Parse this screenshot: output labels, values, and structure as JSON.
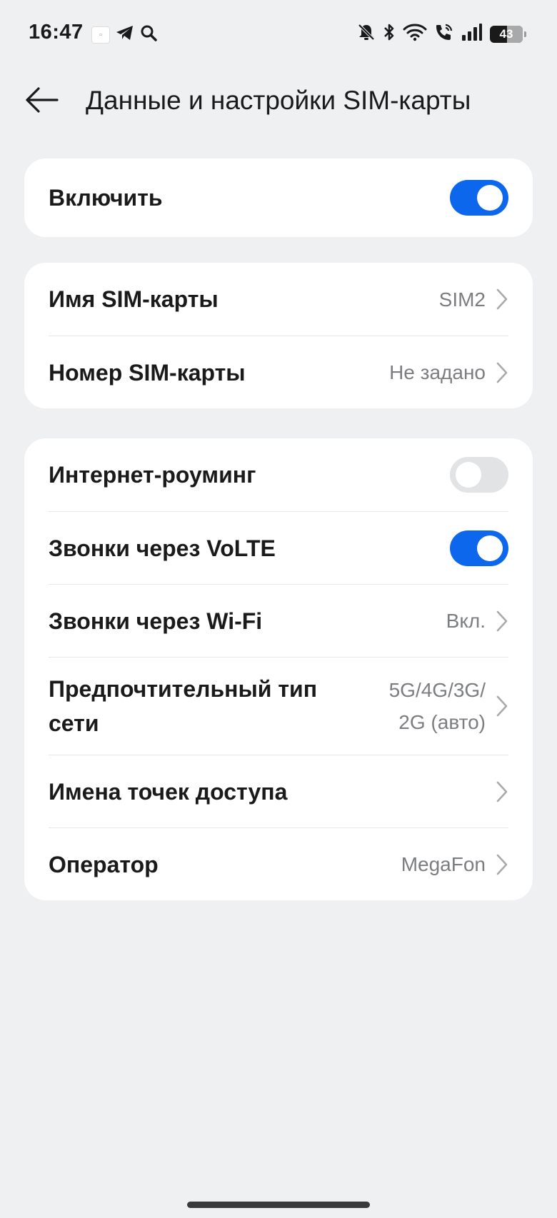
{
  "status_bar": {
    "time": "16:47",
    "battery_level": "43",
    "left_icons": [
      "realme-app-icon",
      "telegram-icon",
      "search-icon"
    ],
    "right_icons": [
      "bell-muted-icon",
      "bluetooth-icon",
      "wifi-icon",
      "wifi-call-icon",
      "signal-icon",
      "battery-icon"
    ]
  },
  "header": {
    "title": "Данные и настройки SIM-карты",
    "back_icon": "arrow-left-icon"
  },
  "cards": {
    "enable": {
      "label": "Включить",
      "state": "on"
    },
    "identity": {
      "name_label": "Имя SIM-карты",
      "name_value": "SIM2",
      "number_label": "Номер SIM-карты",
      "number_value": "Не задано"
    },
    "network": {
      "roaming_label": "Интернет-роуминг",
      "roaming_state": "off",
      "volte_label": "Звонки через VoLTE",
      "volte_state": "on",
      "wifi_calls_label": "Звонки через Wi-Fi",
      "wifi_calls_value": "Вкл.",
      "network_type_label": "Предпочтительный тип\nсети",
      "network_type_value": "5G/4G/3G/\n2G (авто)",
      "apn_label": "Имена точек доступа",
      "operator_label": "Оператор",
      "operator_value": "MegaFon"
    }
  },
  "colors": {
    "accent": "#0d67ec",
    "background": "#eff0f2",
    "card": "#ffffff",
    "secondary_text": "#7b7d80"
  }
}
